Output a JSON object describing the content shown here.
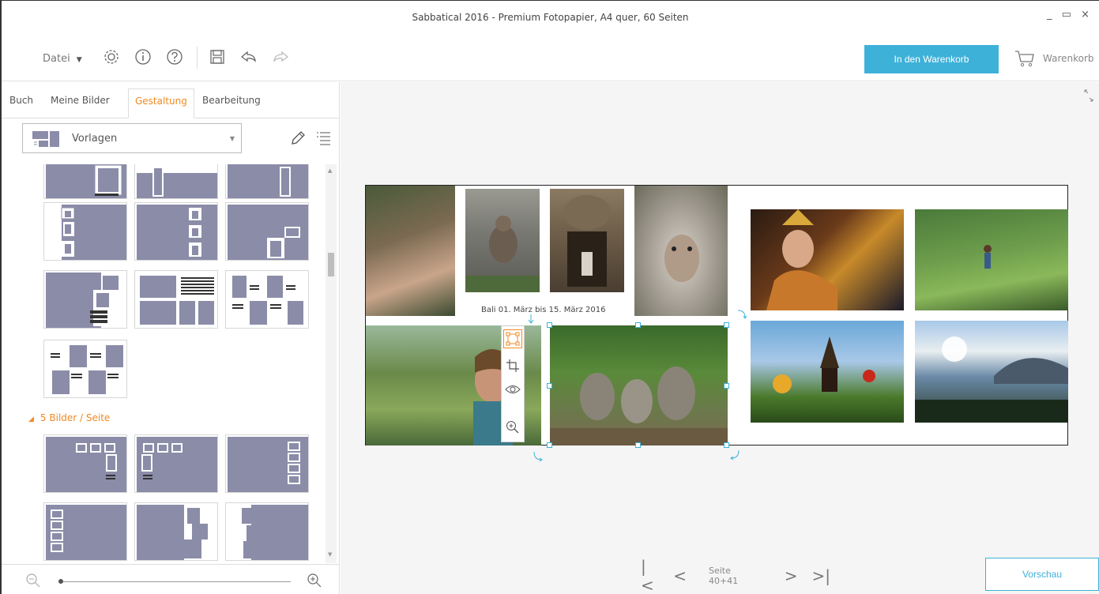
{
  "window": {
    "title": "Sabbatical 2016 - Premium Fotopapier, A4 quer, 60 Seiten",
    "controls": "_ ▭ ×"
  },
  "toolbar": {
    "file_label": "Datei",
    "cart_button": "In den Warenkorb",
    "cart_link": "Warenkorb",
    "icons": [
      "settings-gear-icon",
      "info-icon",
      "help-icon",
      "save-icon",
      "undo-icon",
      "redo-icon"
    ]
  },
  "left_panel": {
    "tabs": [
      {
        "label": "Buch",
        "active": false
      },
      {
        "label": "Meine Bilder",
        "active": false
      },
      {
        "label": "Gestaltung",
        "active": true
      },
      {
        "label": "Bearbeitung",
        "active": false
      }
    ],
    "dropdown": {
      "selected": "Vorlagen"
    },
    "section_label": "5 Bilder / Seite"
  },
  "canvas": {
    "caption": "Bali 01. März bis 15. März 2016",
    "page_label": "Seite 40+41",
    "preview_button": "Vorschau"
  },
  "colors": {
    "accent_orange": "#f08a24",
    "accent_blue": "#3eb1d9",
    "template_fill": "#8b8ca8"
  }
}
